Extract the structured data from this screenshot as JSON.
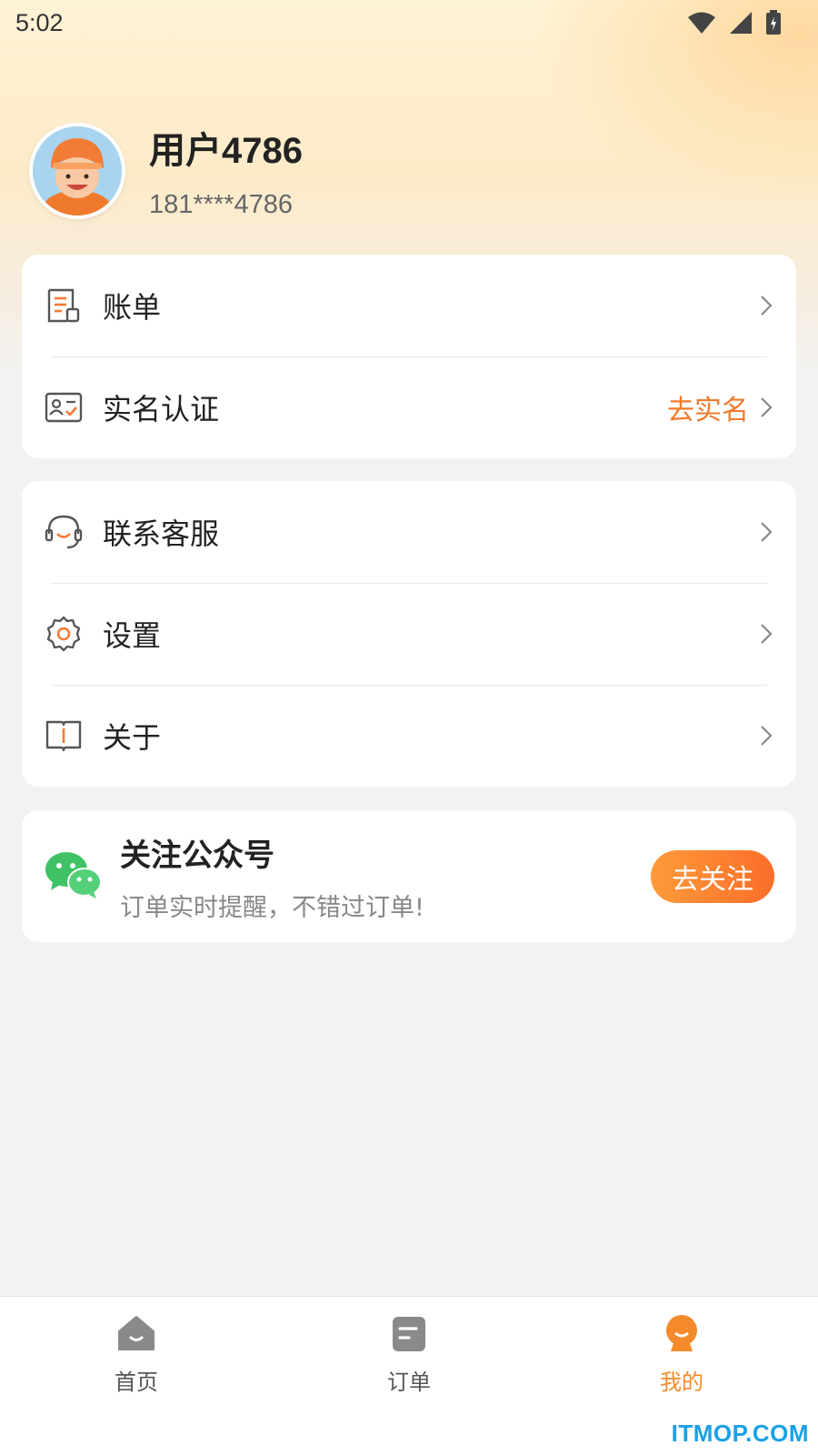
{
  "status_bar": {
    "time": "5:02"
  },
  "profile": {
    "name": "用户4786",
    "phone": "181****4786"
  },
  "card1": {
    "items": [
      {
        "label": "账单",
        "icon": "bill-icon"
      },
      {
        "label": "实名认证",
        "extra": "去实名",
        "icon": "id-card-icon"
      }
    ]
  },
  "card2": {
    "items": [
      {
        "label": "联系客服",
        "icon": "headset-icon"
      },
      {
        "label": "设置",
        "icon": "gear-icon"
      },
      {
        "label": "关于",
        "icon": "book-icon"
      }
    ]
  },
  "follow": {
    "title": "关注公众号",
    "subtitle": "订单实时提醒，不错过订单!",
    "button": "去关注",
    "icon": "wechat-icon"
  },
  "tabs": [
    {
      "label": "首页",
      "icon": "home-icon",
      "active": false
    },
    {
      "label": "订单",
      "icon": "order-icon",
      "active": false
    },
    {
      "label": "我的",
      "icon": "profile-icon",
      "active": true
    }
  ],
  "watermark": "ITMOP.COM",
  "colors": {
    "accent": "#f58a2a",
    "icon_accent": "#f47a36",
    "wechat_green": "#3fc265"
  }
}
